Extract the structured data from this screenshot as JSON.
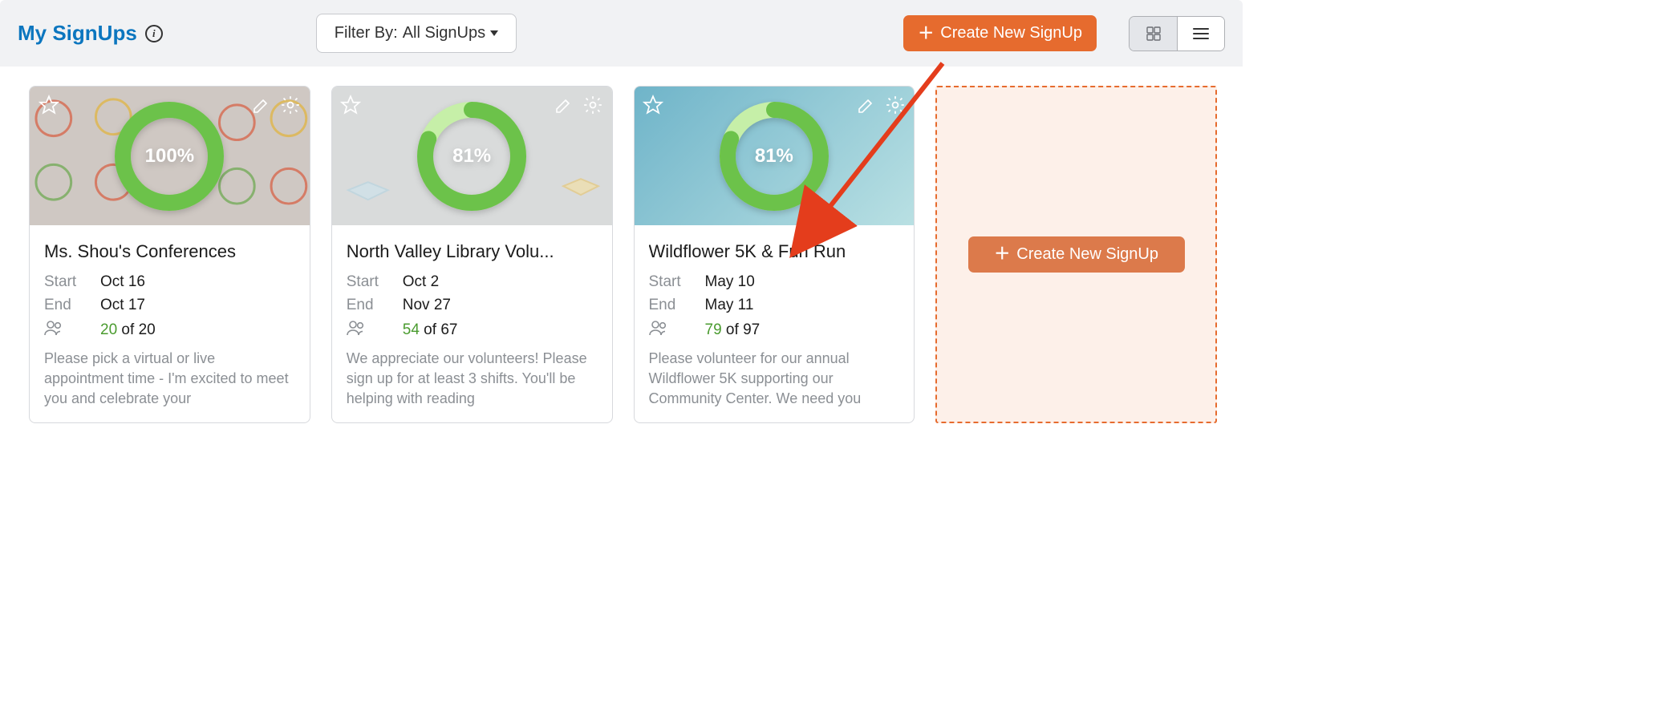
{
  "header": {
    "title": "My SignUps",
    "filter_prefix": "Filter By: ",
    "filter_value": "All SignUps",
    "create_label": "Create New SignUp"
  },
  "labels": {
    "start": "Start",
    "end": "End",
    "of": "of"
  },
  "cards": [
    {
      "title": "Ms. Shou's Conferences",
      "start": "Oct 16",
      "end": "Oct 17",
      "filled": 20,
      "total": 20,
      "percent": 100,
      "desc": "Please pick a virtual or live appointment time - I'm excited to meet you and celebrate your"
    },
    {
      "title": "North Valley Library Volu...",
      "start": "Oct 2",
      "end": "Nov 27",
      "filled": 54,
      "total": 67,
      "percent": 81,
      "desc": "We appreciate our volunteers! Please sign up for at least 3 shifts. You'll be helping with reading"
    },
    {
      "title": "Wildflower 5K & Fun Run",
      "start": "May 10",
      "end": "May 11",
      "filled": 79,
      "total": 97,
      "percent": 81,
      "desc": "Please volunteer for our annual Wildflower 5K supporting our Community Center. We need you"
    }
  ],
  "create_card": {
    "label": "Create New SignUp"
  },
  "chart_data": [
    {
      "type": "pie",
      "title": "Ms. Shou's Conferences completion",
      "categories": [
        "filled",
        "remaining"
      ],
      "values": [
        100,
        0
      ]
    },
    {
      "type": "pie",
      "title": "North Valley Library completion",
      "categories": [
        "filled",
        "remaining"
      ],
      "values": [
        81,
        19
      ]
    },
    {
      "type": "pie",
      "title": "Wildflower 5K completion",
      "categories": [
        "filled",
        "remaining"
      ],
      "values": [
        81,
        19
      ]
    }
  ]
}
